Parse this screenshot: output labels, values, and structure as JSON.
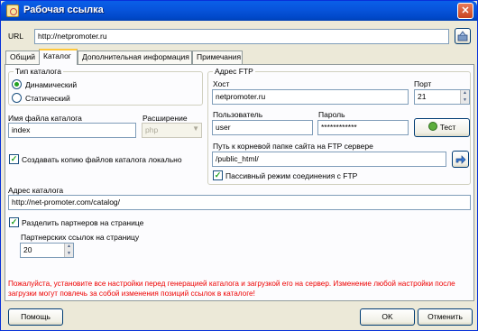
{
  "window": {
    "title": "Рабочая ссылка",
    "close_symbol": "✕"
  },
  "url": {
    "label": "URL",
    "value": "http://netpromoter.ru"
  },
  "tabs": [
    {
      "label": "Общий"
    },
    {
      "label": "Каталог"
    },
    {
      "label": "Дополнительная информация"
    },
    {
      "label": "Примечания"
    }
  ],
  "catalog_type": {
    "title": "Тип каталога",
    "options": [
      {
        "label": "Динамический",
        "selected": true
      },
      {
        "label": "Статический",
        "selected": false
      }
    ]
  },
  "catalog_file": {
    "label": "Имя файла каталога",
    "value": "index"
  },
  "extension": {
    "label": "Расширение",
    "value": "php"
  },
  "copy_local": {
    "label": "Создавать копию файлов каталога локально",
    "checked": true
  },
  "ftp": {
    "title": "Адрес FTP",
    "host_label": "Хост",
    "host_value": "netpromoter.ru",
    "port_label": "Порт",
    "port_value": "21",
    "user_label": "Пользователь",
    "user_value": "user",
    "password_label": "Пароль",
    "password_value": "************",
    "test_label": "Тест",
    "root_path_label": "Путь к корневой папке сайта на FTP сервере",
    "root_path_value": "/public_html/",
    "passive_label": "Пассивный режим соединения с FTP",
    "passive_checked": true
  },
  "catalog_address": {
    "label": "Адрес каталога",
    "value": "http://net-promoter.com/catalog/"
  },
  "split_partners": {
    "label": "Разделить партнеров на странице",
    "checked": true
  },
  "links_per_page": {
    "label": "Партнерских ссылок на страницу",
    "value": "20"
  },
  "warning": "Пожалуйста, установите все настройки перед генерацией каталога и загрузкой его на сервер. Изменение любой настройки после загрузки могут повлечь за собой изменения позиций ссылок в каталоге!",
  "buttons": {
    "help": "Помощь",
    "ok": "OK",
    "cancel": "Отменить"
  },
  "colors": {
    "accent": "#0855dd",
    "warning": "#ee0000",
    "check": "#21a121"
  }
}
